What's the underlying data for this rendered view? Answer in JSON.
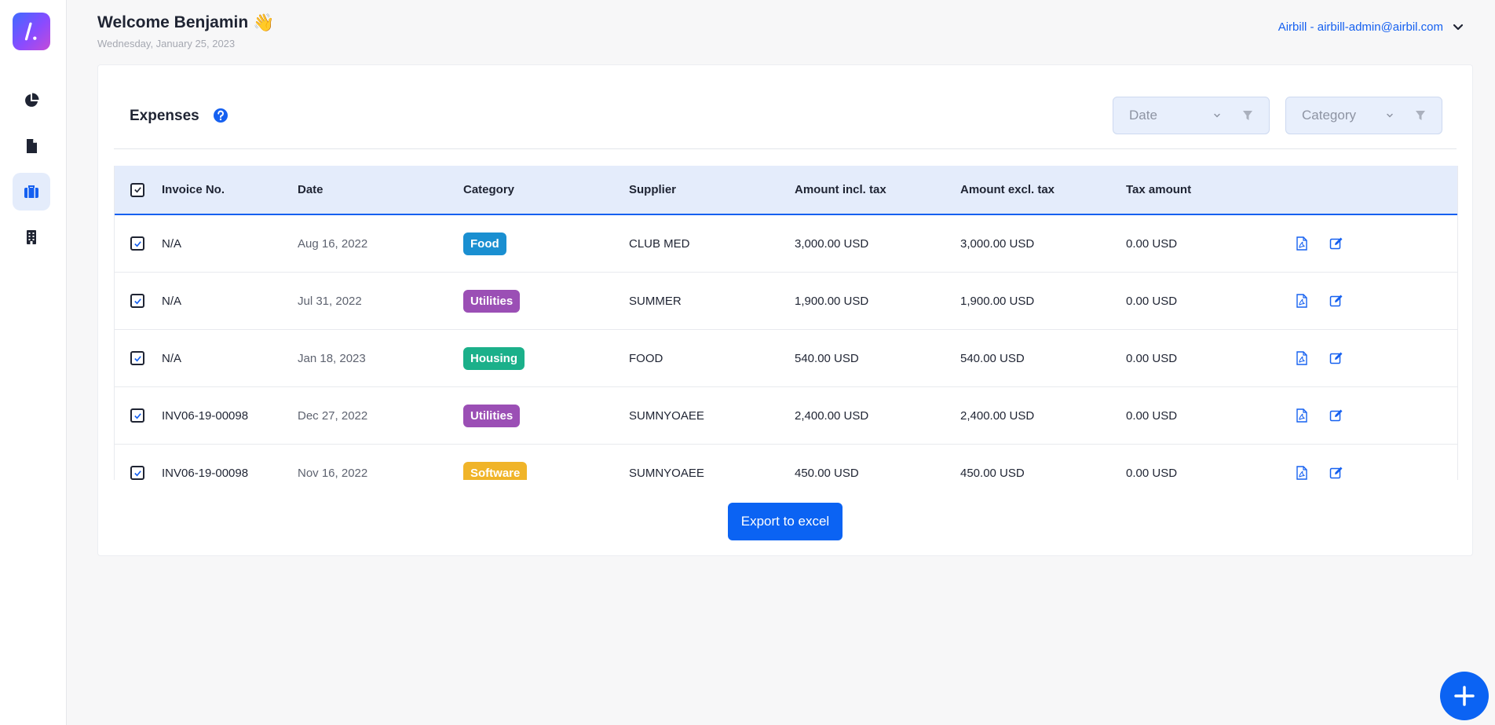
{
  "header": {
    "welcome": "Welcome Benjamin",
    "wave_emoji": "👋",
    "date": "Wednesday, January 25, 2023",
    "account": "Airbill - airbill-admin@airbil.com"
  },
  "sidebar": {
    "items": [
      {
        "name": "dashboard",
        "icon": "pie-chart-icon"
      },
      {
        "name": "documents",
        "icon": "file-icon"
      },
      {
        "name": "expenses",
        "icon": "briefcase-icon",
        "active": true
      },
      {
        "name": "company",
        "icon": "building-icon"
      }
    ]
  },
  "card": {
    "title": "Expenses",
    "filters": {
      "date_label": "Date",
      "category_label": "Category"
    },
    "export_label": "Export to excel"
  },
  "table": {
    "columns": [
      "Invoice No.",
      "Date",
      "Category",
      "Supplier",
      "Amount incl. tax",
      "Amount excl. tax",
      "Tax amount"
    ],
    "rows": [
      {
        "invoice": "N/A",
        "date": "Aug 16, 2022",
        "category": "Food",
        "category_color": "#1a8fd1",
        "supplier": "CLUB MED",
        "incl": "3,000.00 USD",
        "excl": "3,000.00 USD",
        "tax": "0.00 USD"
      },
      {
        "invoice": "N/A",
        "date": "Jul 31, 2022",
        "category": "Utilities",
        "category_color": "#9b4fb5",
        "supplier": "SUMMER",
        "incl": "1,900.00 USD",
        "excl": "1,900.00 USD",
        "tax": "0.00 USD"
      },
      {
        "invoice": "N/A",
        "date": "Jan 18, 2023",
        "category": "Housing",
        "category_color": "#1bb08a",
        "supplier": "FOOD",
        "incl": "540.00 USD",
        "excl": "540.00 USD",
        "tax": "0.00 USD"
      },
      {
        "invoice": "INV06-19-00098",
        "date": "Dec 27, 2022",
        "category": "Utilities",
        "category_color": "#9b4fb5",
        "supplier": "SUMNYOAEE",
        "incl": "2,400.00 USD",
        "excl": "2,400.00 USD",
        "tax": "0.00 USD"
      },
      {
        "invoice": "INV06-19-00098",
        "date": "Nov 16, 2022",
        "category": "Software",
        "category_color": "#f0b429",
        "supplier": "SUMNYOAEE",
        "incl": "450.00 USD",
        "excl": "450.00 USD",
        "tax": "0.00 USD"
      }
    ]
  },
  "colors": {
    "accent": "#0b63f3",
    "header_bg": "#e4ecfb"
  }
}
